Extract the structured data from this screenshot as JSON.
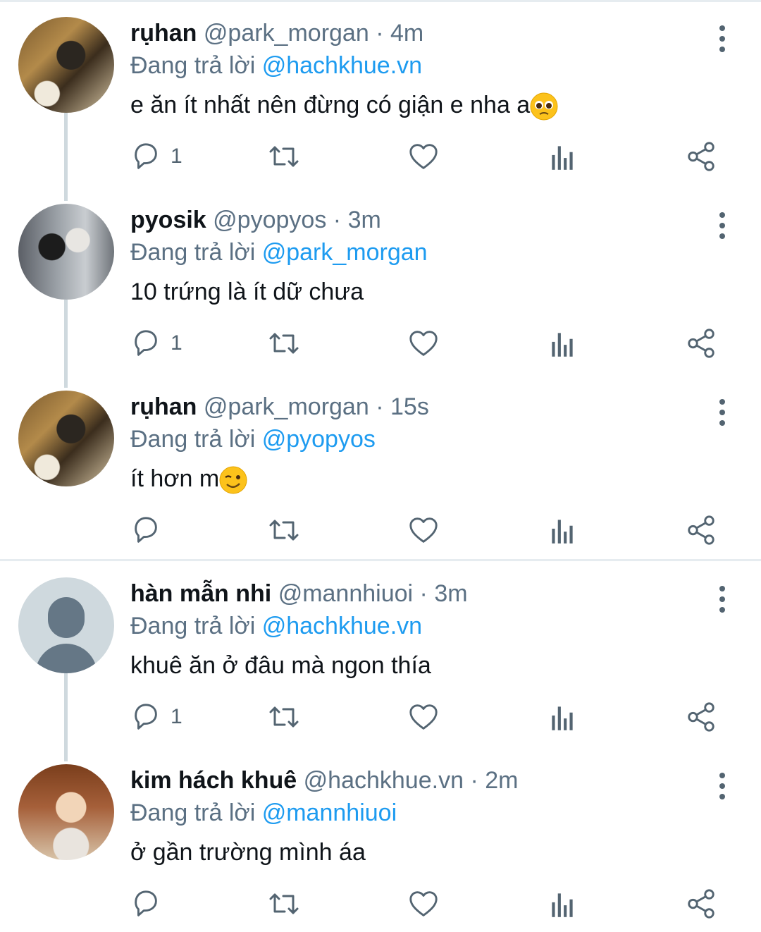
{
  "reply_prefix": "Đang trả lời",
  "tweets": [
    {
      "name": "rụhan",
      "handle": "@park_morgan",
      "dot": "·",
      "time": "4m",
      "replying_to": "@hachkhue.vn",
      "text": "e ăn ít nhất nên đừng có giận e nha a",
      "emoji": "pleading-face",
      "reply_count": "1"
    },
    {
      "name": "pyosik",
      "handle": "@pyopyos",
      "dot": "·",
      "time": "3m",
      "replying_to": "@park_morgan",
      "text": "10 trứng là ít dữ chưa",
      "reply_count": "1"
    },
    {
      "name": "rụhan",
      "handle": "@park_morgan",
      "dot": "·",
      "time": "15s",
      "replying_to": "@pyopyos",
      "text": "ít hơn m",
      "emoji": "winking-face",
      "reply_count": ""
    },
    {
      "name": "hàn mẫn nhi",
      "handle": "@mannhiuoi",
      "dot": "·",
      "time": "3m",
      "replying_to": "@hachkhue.vn",
      "text": "khuê ăn ở đâu mà ngon thía",
      "reply_count": "1"
    },
    {
      "name": "kim hách khuê",
      "handle": "@hachkhue.vn",
      "dot": "·",
      "time": "2m",
      "replying_to": "@mannhiuoi",
      "text": "ở gần trường mình áa",
      "reply_count": ""
    }
  ],
  "colors": {
    "link": "#1d9bf0",
    "secondary": "#5b7083",
    "divider": "#e6ecf0"
  }
}
